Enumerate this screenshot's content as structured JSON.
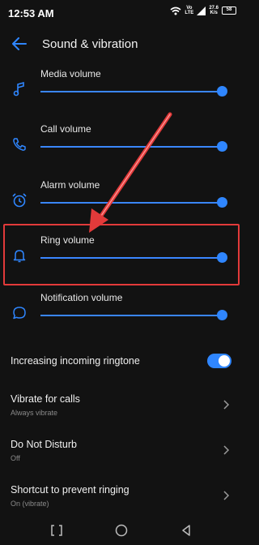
{
  "status_bar": {
    "time": "12:53 AM",
    "network_top": "Vo",
    "network_bottom": "LTE",
    "speed_value": "27.6",
    "speed_unit": "K/s",
    "battery": "58"
  },
  "header": {
    "title": "Sound & vibration",
    "back_icon": "arrow-left-icon"
  },
  "volumes": [
    {
      "label": "Media volume",
      "icon": "music-note-icon",
      "level": 1.0
    },
    {
      "label": "Call volume",
      "icon": "phone-icon",
      "level": 1.0
    },
    {
      "label": "Alarm volume",
      "icon": "alarm-clock-icon",
      "level": 1.0
    },
    {
      "label": "Ring volume",
      "icon": "bell-icon",
      "level": 1.0
    },
    {
      "label": "Notification volume",
      "icon": "chat-bubble-icon",
      "level": 1.0
    }
  ],
  "settings": {
    "increasing_ringtone": {
      "label": "Increasing incoming ringtone",
      "enabled": true
    },
    "vibrate_calls": {
      "title": "Vibrate for calls",
      "subtitle": "Always vibrate"
    },
    "do_not_disturb": {
      "title": "Do Not Disturb",
      "subtitle": "Off"
    },
    "prevent_ringing": {
      "title": "Shortcut to prevent ringing",
      "subtitle": "On (vibrate)"
    }
  },
  "colors": {
    "accent": "#2f86ff",
    "background": "#121212",
    "highlight": "#e23a3a"
  }
}
